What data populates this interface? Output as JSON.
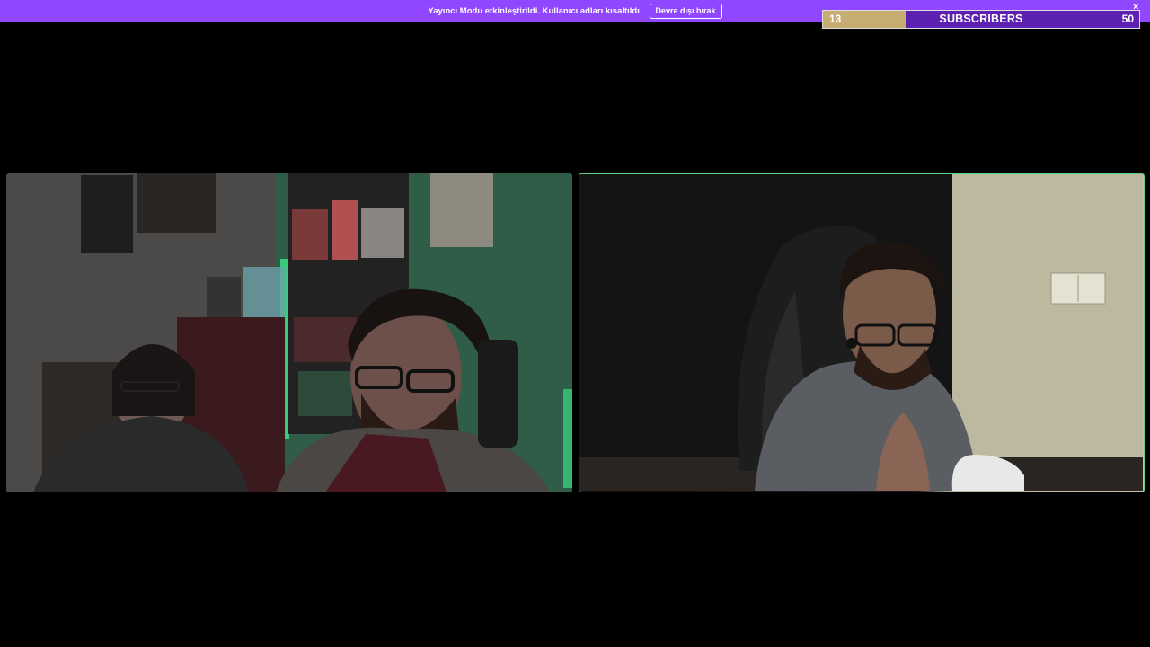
{
  "banner": {
    "message": "Yayıncı Modu etkinleştirildi. Kullanıcı adları kısaltıldı.",
    "button_label": "Devre dışı bırak",
    "close_symbol": "×",
    "background_color": "#9147ff"
  },
  "subscriber_goal": {
    "current": "13",
    "label": "SUBSCRIBERS",
    "target": "50",
    "progress": 0.26,
    "fill_color": "#c8ad73",
    "bar_color": "#5c21b0"
  },
  "video_panels": [
    {
      "id": "left-camera",
      "active": false
    },
    {
      "id": "right-camera",
      "active": true,
      "highlight_color": "#5fd08a"
    }
  ]
}
